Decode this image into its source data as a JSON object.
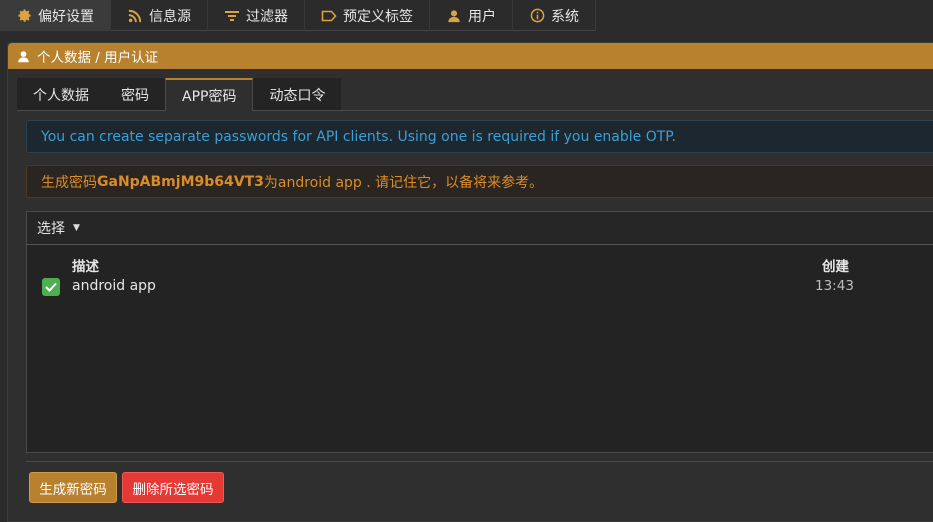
{
  "topnav": {
    "items": [
      {
        "label": "偏好设置",
        "icon": "gear-icon"
      },
      {
        "label": "信息源",
        "icon": "rss-icon"
      },
      {
        "label": "过滤器",
        "icon": "filter-icon"
      },
      {
        "label": "预定义标签",
        "icon": "label-icon"
      },
      {
        "label": "用户",
        "icon": "user-icon"
      },
      {
        "label": "系统",
        "icon": "info-icon"
      }
    ],
    "active_index": 0
  },
  "panel": {
    "title": "个人数据 / 用户认证",
    "icon": "user-icon"
  },
  "tabs": [
    {
      "label": "个人数据"
    },
    {
      "label": "密码"
    },
    {
      "label": "APP密码"
    },
    {
      "label": "动态口令"
    }
  ],
  "active_tab": 2,
  "alerts": {
    "info": "You can create separate passwords for API clients. Using one is required if you enable OTP.",
    "warn_prefix": "生成密码",
    "warn_password": "GaNpABmjM9b64VT3",
    "warn_suffix": "为android app . 请记住它，以备将来参考。"
  },
  "table": {
    "toolbar_select": "选择",
    "columns": {
      "description": "描述",
      "created": "创建"
    },
    "rows": [
      {
        "description": "android app",
        "created": "13:43",
        "checked": true
      }
    ]
  },
  "footer": {
    "generate_label": "生成新密码",
    "delete_label": "删除所选密码"
  },
  "colors": {
    "accent": "#b8812e",
    "danger": "#e53935",
    "info_text": "#3a9fd6",
    "warn_text": "#d98c2a",
    "checkbox": "#4caf50"
  }
}
